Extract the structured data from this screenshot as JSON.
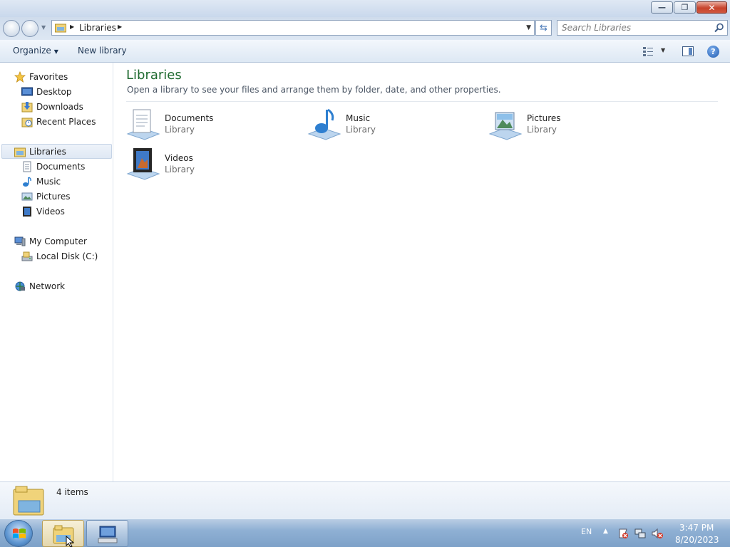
{
  "window": {
    "minimize_glyph": "—",
    "maximize_glyph": "❐",
    "close_glyph": "✕"
  },
  "address": {
    "path_label": "Libraries",
    "search_placeholder": "Search Libraries"
  },
  "toolbar": {
    "organize_label": "Organize",
    "new_library_label": "New library",
    "help_glyph": "?"
  },
  "sidebar": {
    "favorites": {
      "label": "Favorites",
      "items": [
        {
          "label": "Desktop",
          "icon": "desktop-icon"
        },
        {
          "label": "Downloads",
          "icon": "downloads-icon"
        },
        {
          "label": "Recent Places",
          "icon": "recent-places-icon"
        }
      ]
    },
    "libraries": {
      "label": "Libraries",
      "items": [
        {
          "label": "Documents",
          "icon": "documents-icon"
        },
        {
          "label": "Music",
          "icon": "music-icon"
        },
        {
          "label": "Pictures",
          "icon": "pictures-icon"
        },
        {
          "label": "Videos",
          "icon": "videos-icon"
        }
      ]
    },
    "computer": {
      "label": "My Computer",
      "items": [
        {
          "label": "Local Disk (C:)",
          "icon": "drive-icon"
        }
      ]
    },
    "network": {
      "label": "Network"
    }
  },
  "content": {
    "title": "Libraries",
    "description": "Open a library to see your files and arrange them by folder, date, and other properties.",
    "libraries": [
      {
        "name": "Documents",
        "type": "Library"
      },
      {
        "name": "Music",
        "type": "Library"
      },
      {
        "name": "Pictures",
        "type": "Library"
      },
      {
        "name": "Videos",
        "type": "Library"
      }
    ]
  },
  "details": {
    "item_count": "4 items"
  },
  "taskbar": {
    "language": "EN",
    "time": "3:47 PM",
    "date": "8/20/2023"
  },
  "colors": {
    "title_green": "#1e6a2f",
    "accent_blue": "#1f5bb0"
  }
}
